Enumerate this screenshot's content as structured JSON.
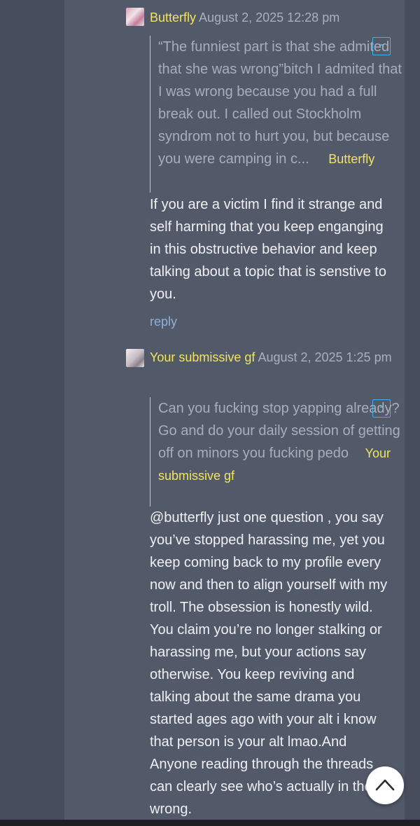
{
  "comments": [
    {
      "username": "Butterfly",
      "date": "August 2, 2025 12:28 pm",
      "quote_text": "“The funniest part is that she admited that she was wrong”bitch I admited that I was wrong because you had a full break out. I called out Stockholm syndrom not to hurt you, but because you were camping in c...",
      "quote_author": "Butterfly",
      "collapse_label": "-",
      "body": "If you are a victim I find it strange and self harming that you keep enganging in this obstructive behavior and keep talking about a topic that is senstive to you.",
      "reply_label": "reply"
    },
    {
      "username": "Your submissive gf",
      "date": "August 2, 2025 1:25 pm",
      "quote_text": "Can you fucking stop yapping already? Go and do your daily session of getting off on minors you fucking pedo",
      "quote_author": "Your submissive gf",
      "collapse_label": "-",
      "body": "@butterfly just one question , you say you’ve stopped harassing me, yet you keep coming back to my profile every now and then to align yourself with my troll. The obsession is honestly wild. You claim you’re no longer stalking or harassing me, but your actions say otherwise. You keep reviving and talking about the same drama you started ages ago with your alt i know that person is your alt lmao.And Anyone reading through the threads can clearly see who’s actually in the wrong."
    }
  ],
  "colors": {
    "username": "#f3e35e",
    "accent": "#3db4f2",
    "link": "#8fb0d8"
  },
  "icons": {
    "scroll_top": "chevron-up-icon"
  }
}
